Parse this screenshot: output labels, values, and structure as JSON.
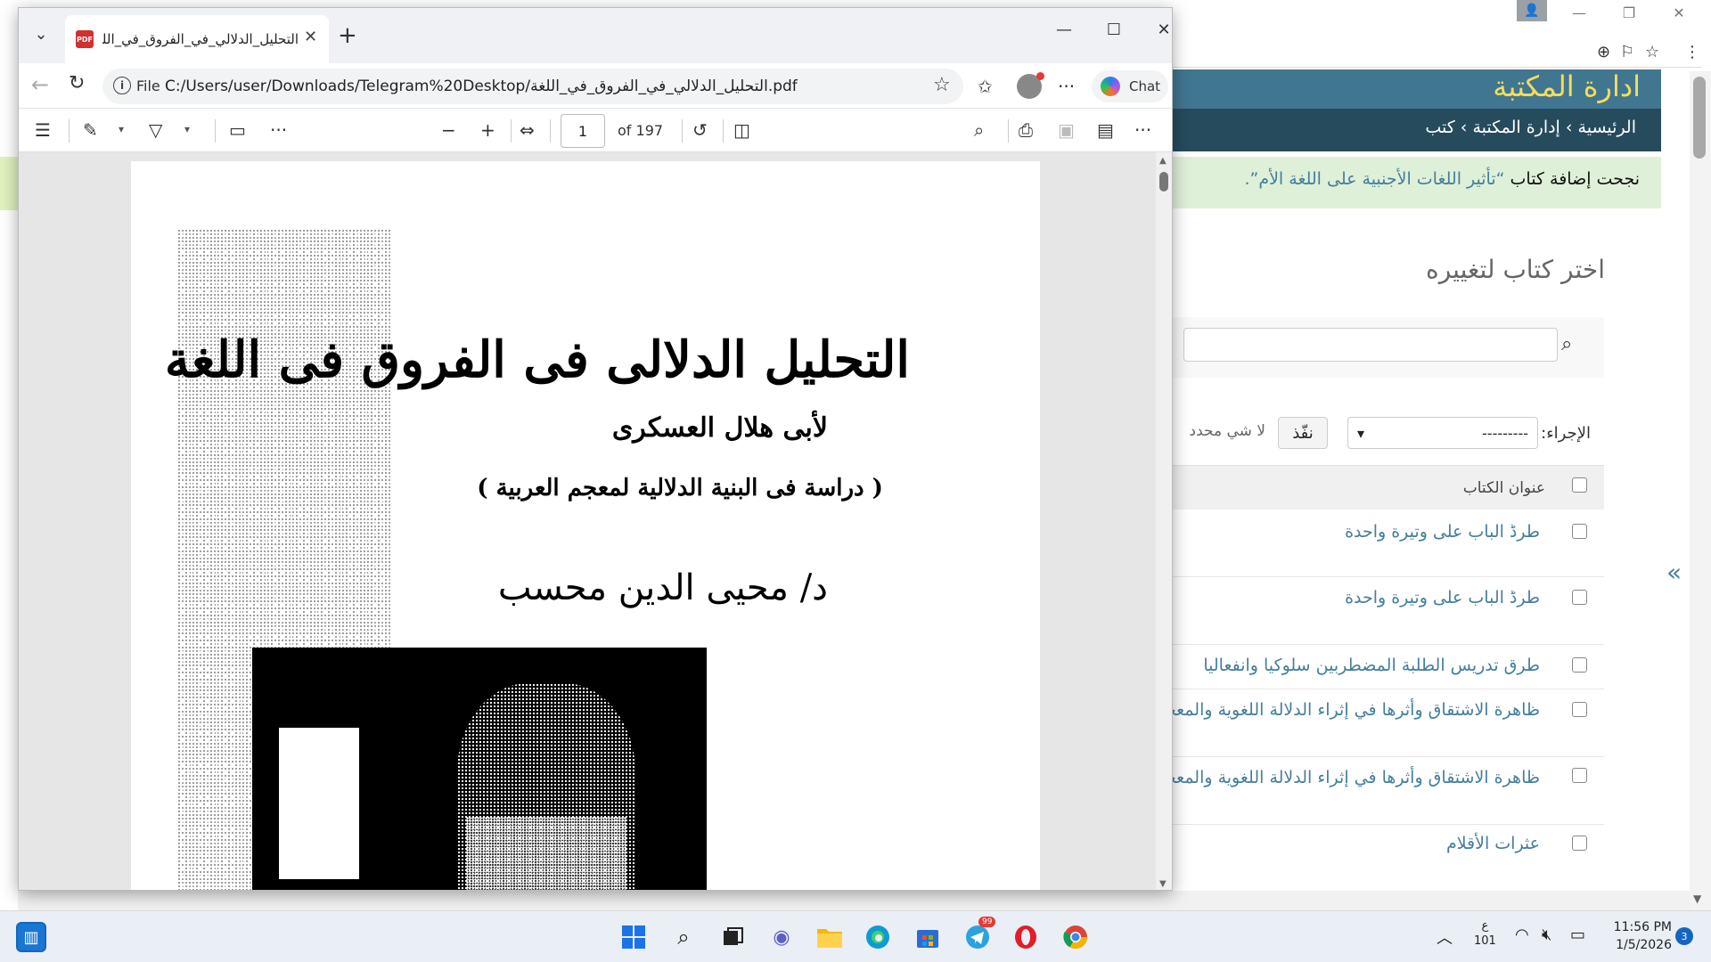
{
  "admin": {
    "site_title": "ادارة المكتبة",
    "breadcrumbs": [
      "الرئيسية",
      "إدارة المكتبة",
      "كتب"
    ],
    "breadcrumb_sep": "›",
    "message_prefix": "نجحت إضافة كتاب",
    "message_title": "“تأثير اللغات الأجنبية على اللغة الأم”.",
    "content_title": "اختر كتاب لتغييره",
    "search_value": "",
    "action_label": "الإجراء:",
    "action_selected": "---------",
    "go_label": "نفّذ",
    "action_counter": "لا شي محدد",
    "column_title": "عنوان الكتاب",
    "rows": [
      {
        "title": "طرڈ الباب على وتيرة واحدة"
      },
      {
        "title": "طرڈ الباب على وتيرة واحدة"
      },
      {
        "title": "طرق تدريس الطلبة المضطربين سلوكيا وانفعاليا"
      },
      {
        "title": "ظاهرة الاشتقاق وأثرها في إثراء الدلالة اللغوية والمعجمية"
      },
      {
        "title": "ظاهرة الاشتقاق وأثرها في إثراء الدلالة اللغوية والمعجمية"
      },
      {
        "title": "عثرات الأقلام"
      }
    ],
    "sidebar_toggle": "«"
  },
  "pdf_window": {
    "tab_title": "التحليل_الدلالي_في_الفروق_في_اللغة.pdf",
    "tab_icon_text": "PDF",
    "new_tab": "+",
    "url_scheme": "File",
    "url": "C:/Users/user/Downloads/Telegram%20Desktop/التحليل_الدلالي_في_الفروق_في_اللغة.pdf",
    "copilot_label": "Chat",
    "page_current": "1",
    "page_total_label": "of 197"
  },
  "pdf_page": {
    "title": "التحليل الدلالى فى الفروق فى اللغة",
    "author": "لأبى هلال العسكرى",
    "subtitle": "( دراسة فى البنية الدلالية لمعجم العربية )",
    "writer": "د/ محيى الدين محسب"
  },
  "taskbar": {
    "lang_top": "ع",
    "lang_bottom": "101",
    "time": "11:56 PM",
    "date": "1/5/2026",
    "notification_count": "3",
    "telegram_badge": "99"
  },
  "icons": {
    "tab_list": "chevron-down-icon",
    "back": "arrow-left-icon",
    "reload": "reload-icon",
    "info": "info-icon",
    "favorite": "star-icon",
    "collections": "star-list-icon",
    "more": "ellipsis-icon",
    "search": "search-icon"
  },
  "colors": {
    "admin_header": "#417690",
    "admin_breadcrumb": "#264b5d",
    "admin_title": "#f5dd5d",
    "admin_link": "#447e9b",
    "success_bg": "#dff0d8"
  }
}
